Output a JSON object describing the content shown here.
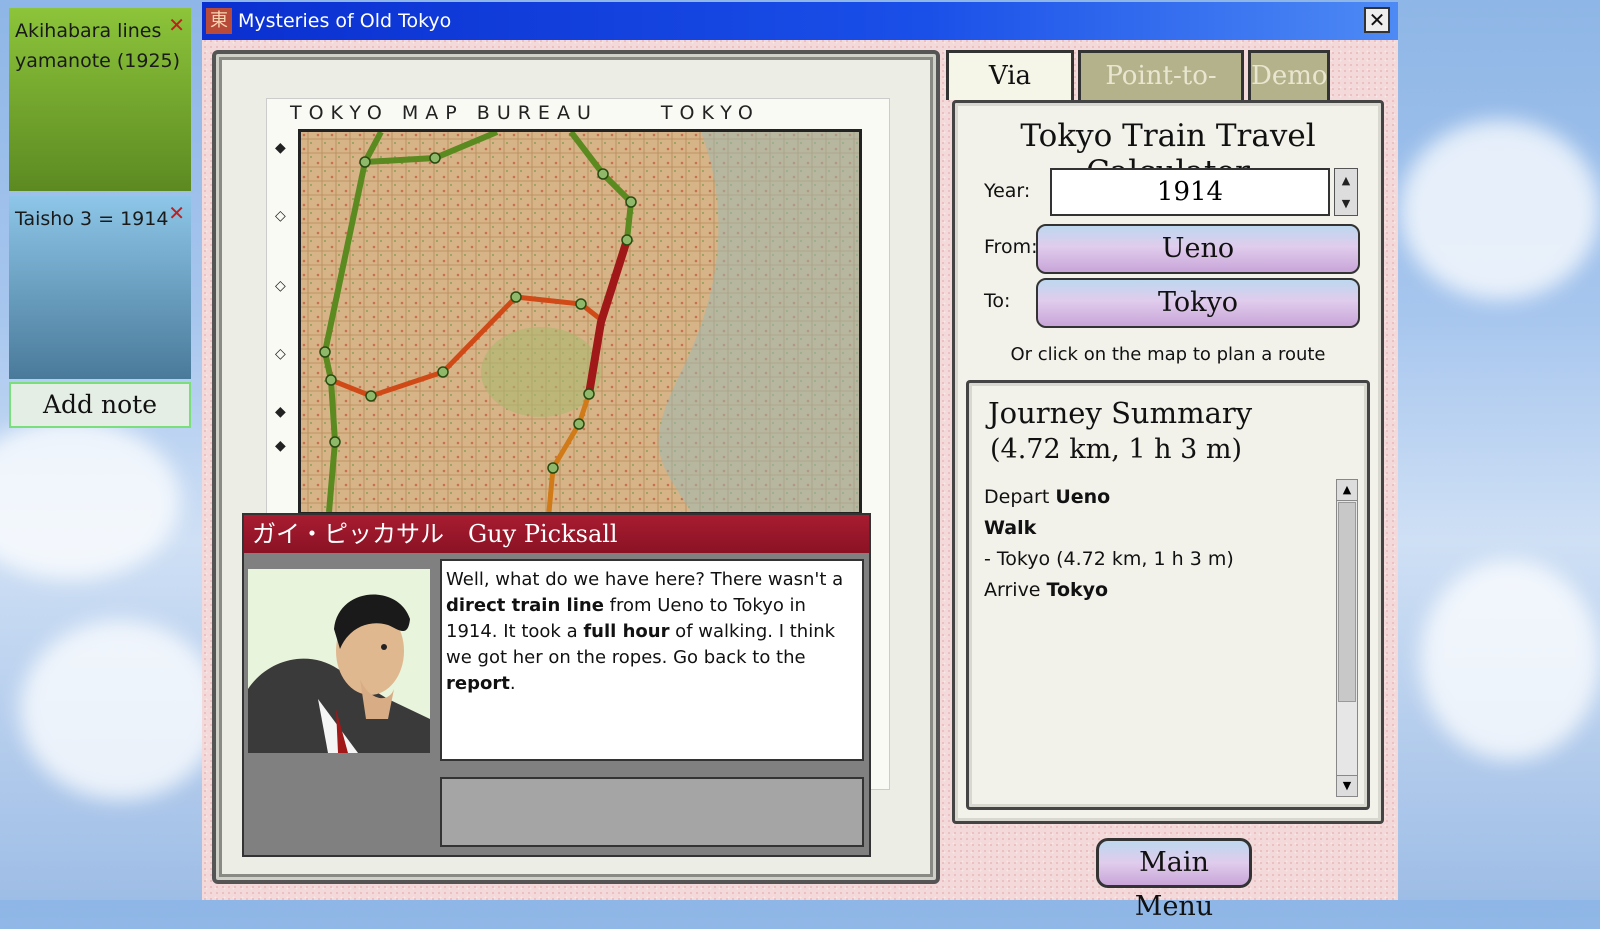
{
  "notes": [
    {
      "text": "Akihabara lines yamanote (1925)"
    },
    {
      "text": "Taisho 3 = 1914"
    }
  ],
  "add_note_label": "Add note",
  "window": {
    "title": "Mysteries of Old Tokyo",
    "icon_glyph": "東",
    "close_glyph": "✕"
  },
  "map": {
    "header_left": "TOKYO MAP BUREAU",
    "header_right": "TOKYO"
  },
  "dialog": {
    "speaker": "ガイ・ピッカサル　Guy Picksall",
    "text_segments": [
      {
        "text": "Well, what do we have here? There wasn't a ",
        "bold": false
      },
      {
        "text": "direct train line",
        "bold": true
      },
      {
        "text": " from Ueno to Tokyo in 1914. It took a ",
        "bold": false
      },
      {
        "text": "full hour",
        "bold": true
      },
      {
        "text": " of walking. I think we got her on the ropes. Go back to the ",
        "bold": false
      },
      {
        "text": "report",
        "bold": true
      },
      {
        "text": ".",
        "bold": false
      }
    ]
  },
  "tabs": [
    {
      "label": "Via Station",
      "active": true
    },
    {
      "label": "Point-to-Point",
      "active": false
    },
    {
      "label": "Demo",
      "active": false
    }
  ],
  "calculator": {
    "title": "Tokyo Train Travel Calculator",
    "year_label": "Year:",
    "year_value": "1914",
    "from_label": "From:",
    "from_value": "Ueno",
    "to_label": "To:",
    "to_value": "Tokyo",
    "hint": "Or click on the map to plan a route"
  },
  "summary": {
    "title": "Journey Summary",
    "subtitle": "(4.72 km, 1 h 3 m)",
    "lines": [
      {
        "prefix": "Depart ",
        "bold": "Ueno"
      },
      {
        "prefix": "",
        "bold": "Walk"
      },
      {
        "prefix": "- Tokyo (4.72 km, 1 h 3 m)",
        "bold": ""
      },
      {
        "prefix": "Arrive ",
        "bold": "Tokyo"
      }
    ]
  },
  "main_menu_label": "Main Menu",
  "colors": {
    "note_green": "#8cc43a",
    "note_blue": "#8dc6e8",
    "title_bar": "#0a2fd0",
    "dialog_title": "#a81c30",
    "line_green": "#5a8a20",
    "line_orange": "#d04a18",
    "line_red": "#a01818"
  }
}
